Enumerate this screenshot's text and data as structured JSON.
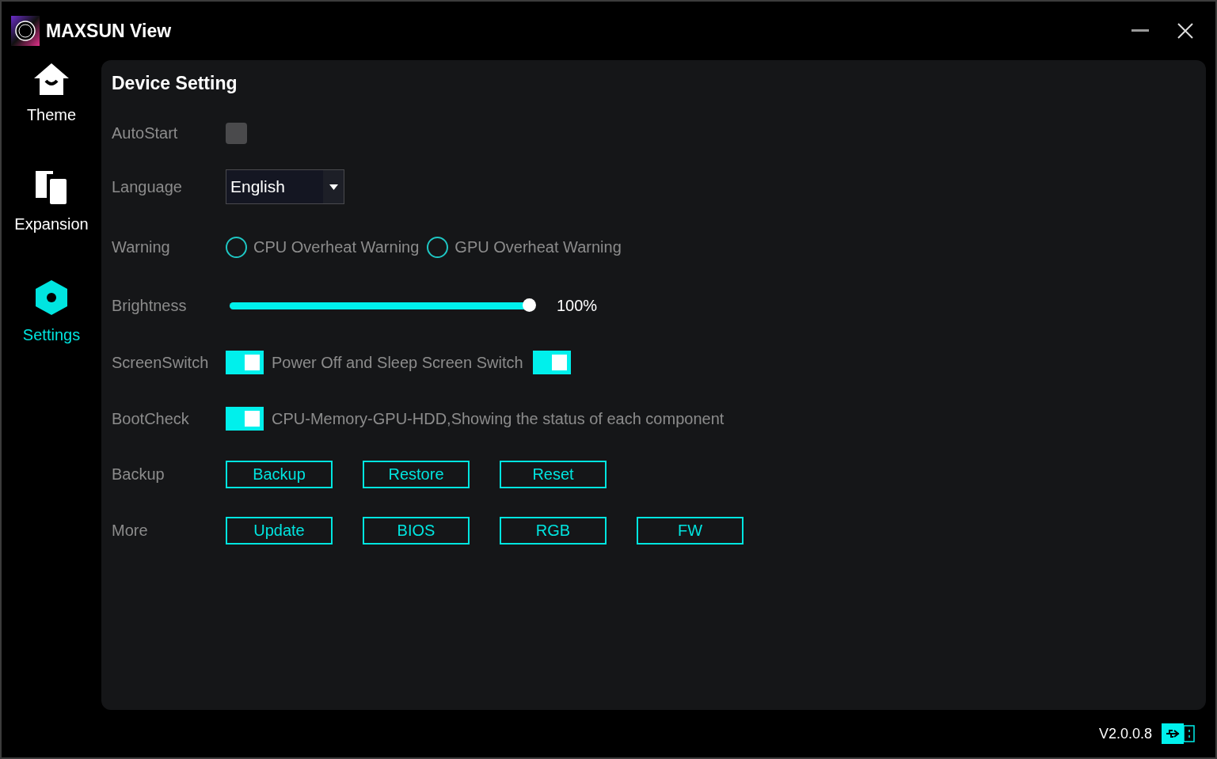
{
  "window": {
    "title": "MAXSUN View"
  },
  "sidebar": {
    "items": [
      {
        "label": "Theme",
        "kind": "home",
        "selected": false
      },
      {
        "label": "Expansion",
        "kind": "pages",
        "selected": false
      },
      {
        "label": "Settings",
        "kind": "hex",
        "selected": true
      }
    ]
  },
  "panel": {
    "title": "Device Setting",
    "rows": [
      {
        "label": "AutoStart",
        "parts": [
          {
            "kind": "checkbox",
            "checked": false
          }
        ]
      },
      {
        "label": "Language",
        "parts": [
          {
            "kind": "dropdown",
            "value": "English"
          }
        ]
      },
      {
        "label": "Warning",
        "parts": [
          {
            "kind": "radio",
            "label": "CPU Overheat Warning",
            "selected": false
          },
          {
            "kind": "radio",
            "label": "GPU Overheat Warning",
            "selected": false
          }
        ]
      },
      {
        "label": "Brightness",
        "parts": [
          {
            "kind": "slider",
            "level": 1,
            "reading": "100%"
          }
        ]
      },
      {
        "label": "ScreenSwitch",
        "parts": [
          {
            "kind": "toggle",
            "on": true
          },
          {
            "kind": "text",
            "text": "Power Off and Sleep Screen Switch"
          },
          {
            "kind": "toggle",
            "on": true
          }
        ]
      },
      {
        "label": "BootCheck",
        "parts": [
          {
            "kind": "toggle",
            "on": true
          },
          {
            "kind": "text",
            "text": "CPU-Memory-GPU-HDD,Showing the status of each component"
          }
        ]
      },
      {
        "label": "Backup",
        "parts": [
          {
            "kind": "button",
            "label": "Backup"
          },
          {
            "kind": "button",
            "label": "Restore"
          },
          {
            "kind": "button",
            "label": "Reset"
          }
        ]
      },
      {
        "label": "More",
        "parts": [
          {
            "kind": "button",
            "label": "Update"
          },
          {
            "kind": "button",
            "label": "BIOS"
          },
          {
            "kind": "button",
            "label": "RGB"
          },
          {
            "kind": "button",
            "label": "FW"
          }
        ]
      }
    ]
  },
  "status_bar": {
    "version": "V2.0.0.8"
  }
}
